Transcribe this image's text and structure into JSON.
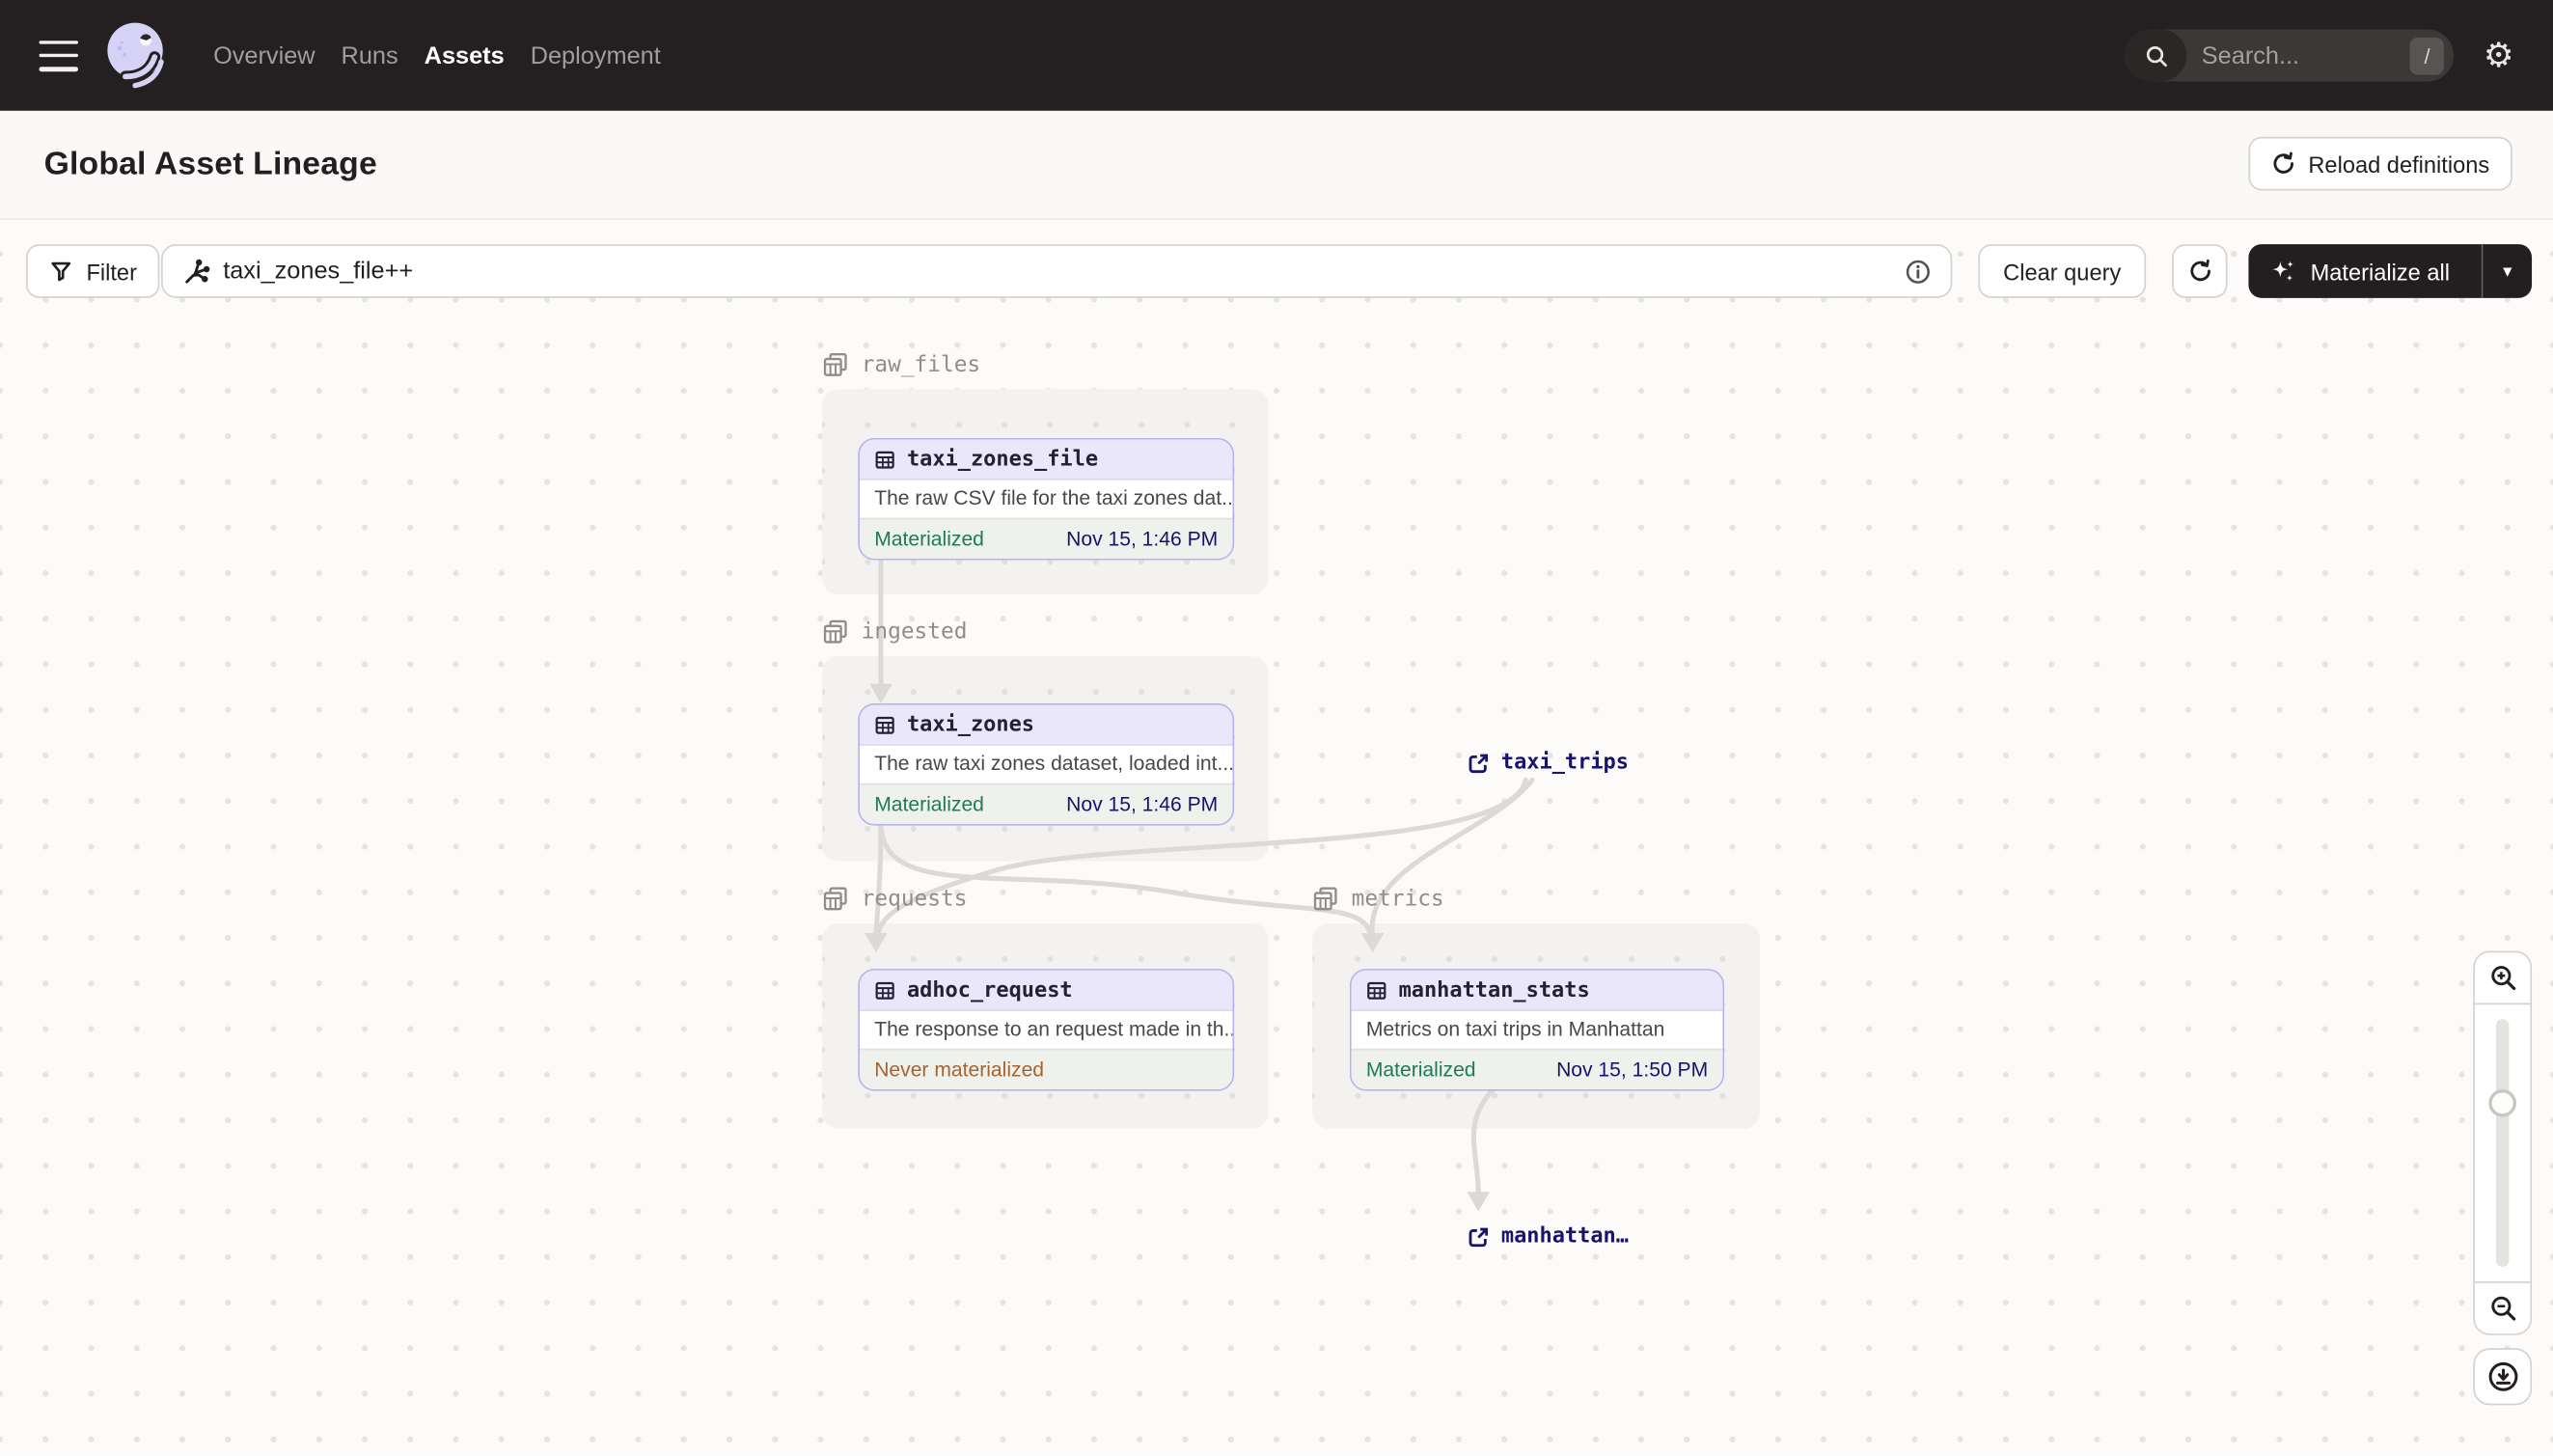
{
  "nav": {
    "items": [
      {
        "label": "Overview",
        "active": false
      },
      {
        "label": "Runs",
        "active": false
      },
      {
        "label": "Assets",
        "active": true
      },
      {
        "label": "Deployment",
        "active": false
      }
    ],
    "search_placeholder": "Search...",
    "search_shortcut": "/"
  },
  "header": {
    "title": "Global Asset Lineage",
    "reload_button": "Reload definitions"
  },
  "toolbar": {
    "filter_button": "Filter",
    "query_value": "taxi_zones_file++",
    "clear_button": "Clear query",
    "materialize_button": "Materialize all"
  },
  "graph": {
    "groups": [
      {
        "name": "raw_files"
      },
      {
        "name": "ingested"
      },
      {
        "name": "requests"
      },
      {
        "name": "metrics"
      }
    ],
    "nodes": [
      {
        "name": "taxi_zones_file",
        "group": "raw_files",
        "description": "The raw CSV file for the taxi zones dat...",
        "status": "Materialized",
        "timestamp": "Nov 15, 1:46 PM"
      },
      {
        "name": "taxi_zones",
        "group": "ingested",
        "description": "The raw taxi zones dataset, loaded int...",
        "status": "Materialized",
        "timestamp": "Nov 15, 1:46 PM"
      },
      {
        "name": "adhoc_request",
        "group": "requests",
        "description": "The response to an request made in th...",
        "status": "Never materialized",
        "timestamp": ""
      },
      {
        "name": "manhattan_stats",
        "group": "metrics",
        "description": "Metrics on taxi trips in Manhattan",
        "status": "Materialized",
        "timestamp": "Nov 15, 1:50 PM"
      }
    ],
    "external_assets": [
      {
        "name": "taxi_trips"
      },
      {
        "name": "manhattan…"
      }
    ],
    "edges": [
      {
        "from": "taxi_zones_file",
        "to": "taxi_zones"
      },
      {
        "from": "taxi_zones",
        "to": "adhoc_request"
      },
      {
        "from": "taxi_zones",
        "to": "manhattan_stats"
      },
      {
        "from": "taxi_trips",
        "to": "adhoc_request"
      },
      {
        "from": "taxi_trips",
        "to": "manhattan_stats"
      },
      {
        "from": "manhattan_stats",
        "to": "manhattan…"
      }
    ]
  },
  "icons": {
    "gear": "⚙",
    "caret_down": "▾",
    "hamburger": "menu-bars",
    "search": "magnifier",
    "filter": "funnel",
    "query_lineage": "graph-asterisk",
    "info": "circle-i",
    "refresh": "circular-arrow",
    "sparkle": "four-point-stars",
    "asset_table": "grid-table",
    "group_tables": "stacked-tables",
    "external_link": "box-arrow-up-right",
    "zoom_in": "magnifier-plus",
    "zoom_out": "magnifier-minus",
    "download": "circle-arrow-down-tray"
  },
  "colors": {
    "nav_bg": "#242021",
    "canvas_bg": "#FCFBFA",
    "group_bg": "#F3F2F0",
    "accent_purple": "#B9B2EC",
    "node_header_bg": "#EAE7FB",
    "footer_bg": "#EFF1EC",
    "materialized_green": "#1D7B5B",
    "never_materialized_amber": "#A6642F",
    "timestamp_navy": "#17136E",
    "link_navy": "#17136E",
    "edge_gray": "#DCD9D6"
  }
}
